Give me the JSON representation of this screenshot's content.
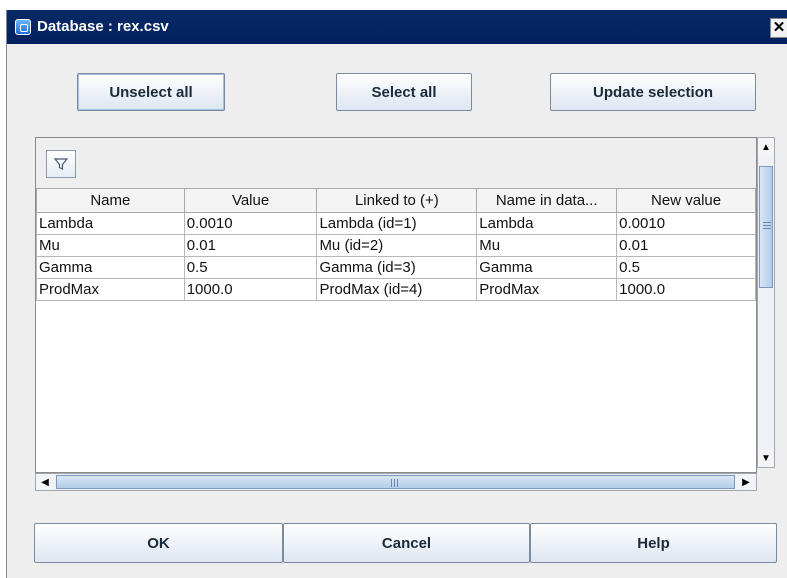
{
  "window": {
    "title": "Database : rex.csv",
    "app_icon": "app-window-icon",
    "close_label": "✕"
  },
  "top_buttons": {
    "unselect_all": "Unselect all",
    "select_all": "Select all",
    "update_selection": "Update selection"
  },
  "toolbar": {
    "filter_icon": "filter-icon"
  },
  "table": {
    "columns": [
      "Name",
      "Value",
      "Linked to (+)",
      "Name in data...",
      "New value"
    ],
    "rows": [
      [
        "Lambda",
        "0.0010",
        "Lambda (id=1)",
        "Lambda",
        "0.0010"
      ],
      [
        "Mu",
        "0.01",
        "Mu (id=2)",
        "Mu",
        "0.01"
      ],
      [
        "Gamma",
        "0.5",
        "Gamma (id=3)",
        "Gamma",
        "0.5"
      ],
      [
        "ProdMax",
        "1000.0",
        "ProdMax (id=4)",
        "ProdMax",
        "1000.0"
      ]
    ]
  },
  "scrollbars": {
    "up_arrow": "▲",
    "down_arrow": "▼",
    "left_arrow": "◀",
    "right_arrow": "▶"
  },
  "bottom_buttons": {
    "ok": "OK",
    "cancel": "Cancel",
    "help": "Help"
  }
}
